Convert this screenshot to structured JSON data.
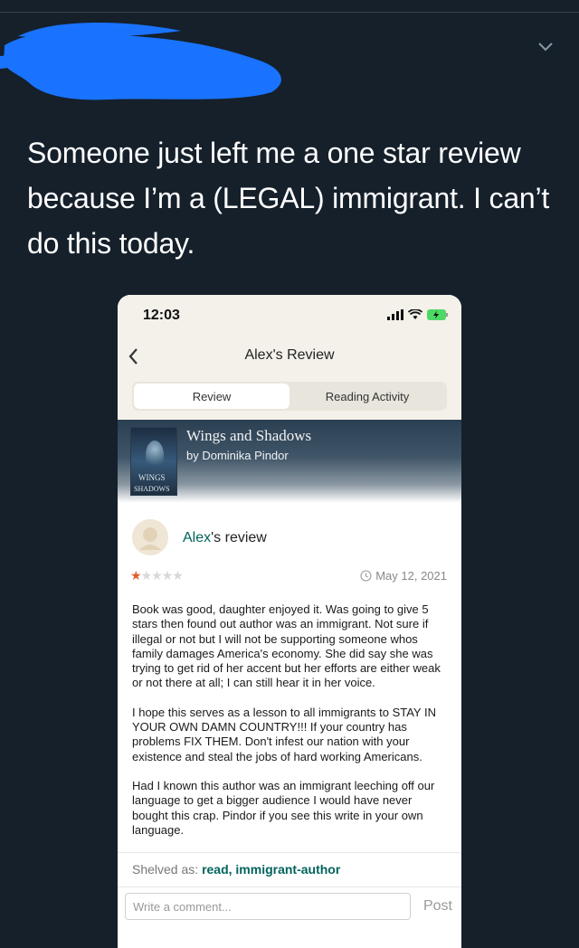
{
  "tweet": {
    "text": "Someone just left me a one star review because I’m a (LEGAL) immigrant. I can’t do this today."
  },
  "phone": {
    "status_time": "12:03",
    "nav_title": "Alex's Review",
    "tabs": [
      {
        "label": "Review",
        "active": true
      },
      {
        "label": "Reading Activity",
        "active": false
      }
    ],
    "book": {
      "title": "Wings and Shadows",
      "author": "by Dominika Pindor",
      "cover_line1": "WINGS",
      "cover_line2": "SHADOWS"
    },
    "review": {
      "reviewer_name": "Alex",
      "reviewer_suffix": "'s review",
      "rating": 1,
      "rating_max": 5,
      "date": "May 12, 2021",
      "paragraphs": [
        "Book was good, daughter enjoyed it. Was going to give 5 stars then found out author was an immigrant. Not sure if illegal or not but I will not be supporting someone whos family damages America's economy. She did say she was trying to get rid of her accent but her efforts are either weak or not there at all; I can still hear it in her voice.",
        "I hope this serves as a lesson to all immigrants to STAY IN YOUR OWN DAMN COUNTRY!!! If your country has problems FIX THEM. Don't infest our nation with your existence and steal the jobs of hard working Americans.",
        "Had I known this author was an immigrant leeching off our language to get a bigger audience I would have never bought this crap. Pindor if you see this write in your own language."
      ],
      "shelved_label": "Shelved as:",
      "shelves": "read, immigrant-author"
    },
    "comment": {
      "placeholder": "Write a comment...",
      "post_label": "Post"
    }
  },
  "colors": {
    "background": "#15202b",
    "accent_link": "#00635d",
    "star": "#e15d2a",
    "redaction": "#1a73ff"
  }
}
